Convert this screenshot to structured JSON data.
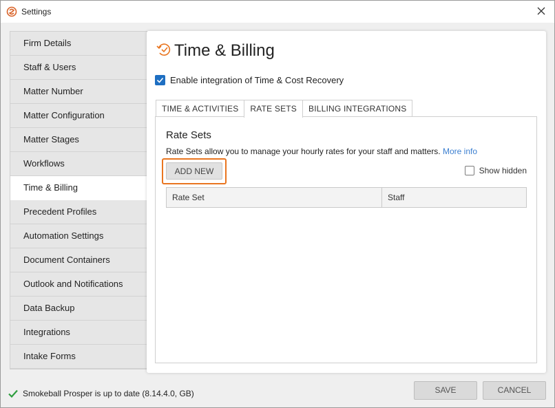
{
  "window": {
    "title": "Settings",
    "icons": {
      "logo": "smokeball-logo-icon",
      "close": "close-icon"
    }
  },
  "sidebar": {
    "items": [
      {
        "label": "Firm Details"
      },
      {
        "label": "Staff & Users"
      },
      {
        "label": "Matter Number"
      },
      {
        "label": "Matter Configuration"
      },
      {
        "label": "Matter Stages"
      },
      {
        "label": "Workflows"
      },
      {
        "label": "Time & Billing",
        "active": true
      },
      {
        "label": "Precedent Profiles"
      },
      {
        "label": "Automation Settings"
      },
      {
        "label": "Document Containers"
      },
      {
        "label": "Outlook and Notifications"
      },
      {
        "label": "Data Backup"
      },
      {
        "label": "Integrations"
      },
      {
        "label": "Intake Forms"
      }
    ]
  },
  "panel": {
    "title": "Time & Billing",
    "title_icon": "time-billing-icon",
    "enable_integration": {
      "label": "Enable integration of Time & Cost Recovery",
      "checked": true
    },
    "tabs": [
      {
        "label": "TIME & ACTIVITIES"
      },
      {
        "label": "RATE SETS",
        "active": true
      },
      {
        "label": "BILLING INTEGRATIONS"
      }
    ],
    "rate_sets": {
      "heading": "Rate Sets",
      "description": "Rate Sets allow you to manage your hourly rates for your staff and matters.",
      "more_info": "More info",
      "add_new": "ADD NEW",
      "show_hidden": {
        "label": "Show hidden",
        "checked": false
      },
      "columns": [
        "Rate Set",
        "Staff"
      ],
      "rows": []
    }
  },
  "status": {
    "text": "Smokeball Prosper is up to date (8.14.4.0, GB)",
    "icon": "checkmark-icon"
  },
  "footer": {
    "save": "SAVE",
    "cancel": "CANCEL"
  },
  "colors": {
    "accent_blue": "#1e6fc2",
    "link": "#3b7fd0",
    "highlight_orange": "#e9751f",
    "brand_orange": "#e9751f",
    "success_green": "#2e9e3f"
  }
}
